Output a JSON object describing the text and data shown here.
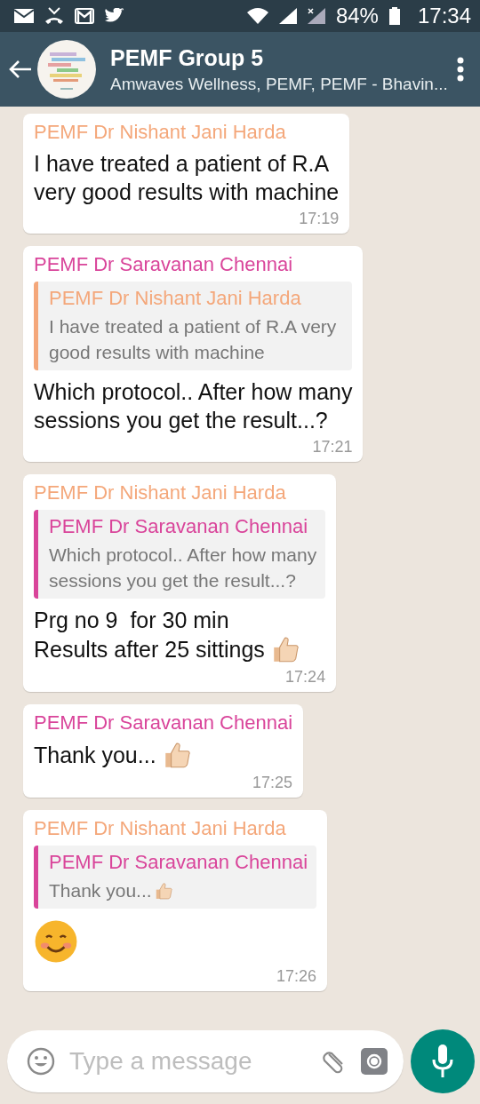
{
  "status_bar": {
    "battery": "84%",
    "time": "17:34"
  },
  "header": {
    "title": "PEMF Group 5",
    "subtitle": "Amwaves Wellness, PEMF, PEMF - Bhavin..."
  },
  "messages": [
    {
      "sender": "PEMF Dr Nishant Jani Harda",
      "color": "#f4a77a",
      "lines": [
        "I have treated a patient of R.A",
        "very good results with machine"
      ],
      "time": "17:19"
    },
    {
      "sender": "PEMF Dr Saravanan Chennai",
      "color": "#d9449a",
      "quote": {
        "sender": "PEMF Dr Nishant Jani Harda",
        "color": "#f4a77a",
        "lines": [
          "I have treated a patient of R.A very",
          "good results with machine"
        ]
      },
      "lines": [
        "Which protocol.. After how many",
        "sessions you get the result...?"
      ],
      "time": "17:21"
    },
    {
      "sender": "PEMF Dr Nishant Jani Harda",
      "color": "#f4a77a",
      "quote": {
        "sender": "PEMF Dr Saravanan Chennai",
        "color": "#d9449a",
        "lines": [
          "Which protocol.. After how many",
          "sessions you get the result...?"
        ]
      },
      "lines": [
        "Prg no 9  for 30 min",
        "Results after 25 sittings"
      ],
      "emoji": {
        "kind": "thumbs-up"
      },
      "time": "17:24"
    },
    {
      "sender": "PEMF Dr Saravanan Chennai",
      "color": "#d9449a",
      "lines": [
        "Thank you..."
      ],
      "emoji": {
        "kind": "thumbs-up"
      },
      "time": "17:25"
    },
    {
      "sender": "PEMF Dr Nishant Jani Harda",
      "color": "#f4a77a",
      "quote": {
        "sender": "PEMF Dr Saravanan Chennai",
        "color": "#d9449a",
        "lines": [
          "Thank you..."
        ],
        "emoji": {
          "kind": "thumbs-up"
        }
      },
      "emoji": {
        "kind": "smile"
      },
      "time": "17:26"
    }
  ],
  "composer": {
    "placeholder": "Type a message"
  }
}
